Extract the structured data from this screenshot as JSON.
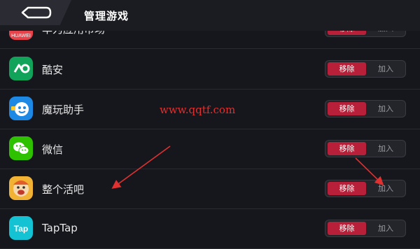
{
  "header": {
    "title": "管理游戏"
  },
  "toggle": {
    "remove_label": "移除",
    "add_label": "加入"
  },
  "apps": [
    {
      "name": "华为应用市场",
      "icon": "huawei-appgallery-icon",
      "color": "#e8424b"
    },
    {
      "name": "酷安",
      "icon": "coolapk-icon",
      "color": "#12a35a"
    },
    {
      "name": "魔玩助手",
      "icon": "mowan-icon",
      "color": "#1e88e5"
    },
    {
      "name": "微信",
      "icon": "wechat-icon",
      "color": "#2dc100"
    },
    {
      "name": "整个活吧",
      "icon": "zhenggehuoba-icon",
      "color": "#f2b234"
    },
    {
      "name": "TapTap",
      "icon": "taptap-icon",
      "color": "#13c2d3"
    }
  ],
  "watermark": "www.qqtf.com",
  "colors": {
    "accent_red": "#b8203a",
    "background": "#16171c",
    "annotation": "#e03030"
  }
}
